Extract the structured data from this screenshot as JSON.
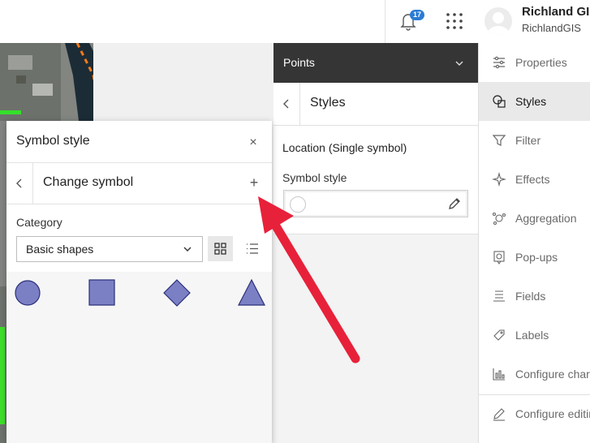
{
  "header": {
    "notifications_count": "17",
    "user_name": "Richland GIS",
    "user_org": "RichlandGIS"
  },
  "layer_panel": {
    "title": "Points",
    "styles_title": "Styles",
    "location_label": "Location (Single symbol)",
    "symbol_style_label": "Symbol style"
  },
  "sidebar": {
    "items": [
      {
        "label": "Properties",
        "icon": "properties-icon"
      },
      {
        "label": "Styles",
        "icon": "styles-icon",
        "active": true
      },
      {
        "label": "Filter",
        "icon": "filter-icon"
      },
      {
        "label": "Effects",
        "icon": "effects-icon"
      },
      {
        "label": "Aggregation",
        "icon": "aggregation-icon"
      },
      {
        "label": "Pop-ups",
        "icon": "popups-icon"
      },
      {
        "label": "Fields",
        "icon": "fields-icon"
      },
      {
        "label": "Labels",
        "icon": "labels-icon"
      },
      {
        "label": "Configure charts",
        "icon": "configure-charts-icon"
      },
      {
        "label": "Configure editing",
        "icon": "configure-editing-icon"
      }
    ]
  },
  "popup": {
    "title": "Symbol style",
    "close_glyph": "×",
    "change_title": "Change symbol",
    "add_glyph": "+",
    "category_label": "Category",
    "category_value": "Basic shapes",
    "symbols": [
      "circle",
      "square",
      "diamond",
      "triangle"
    ],
    "symbol_fill": "#7b7fc4",
    "symbol_stroke": "#2a2f7a"
  },
  "colors": {
    "header_dark": "#353535",
    "accent_badge": "#2b7bd4",
    "annotation_arrow": "#e8213a"
  }
}
